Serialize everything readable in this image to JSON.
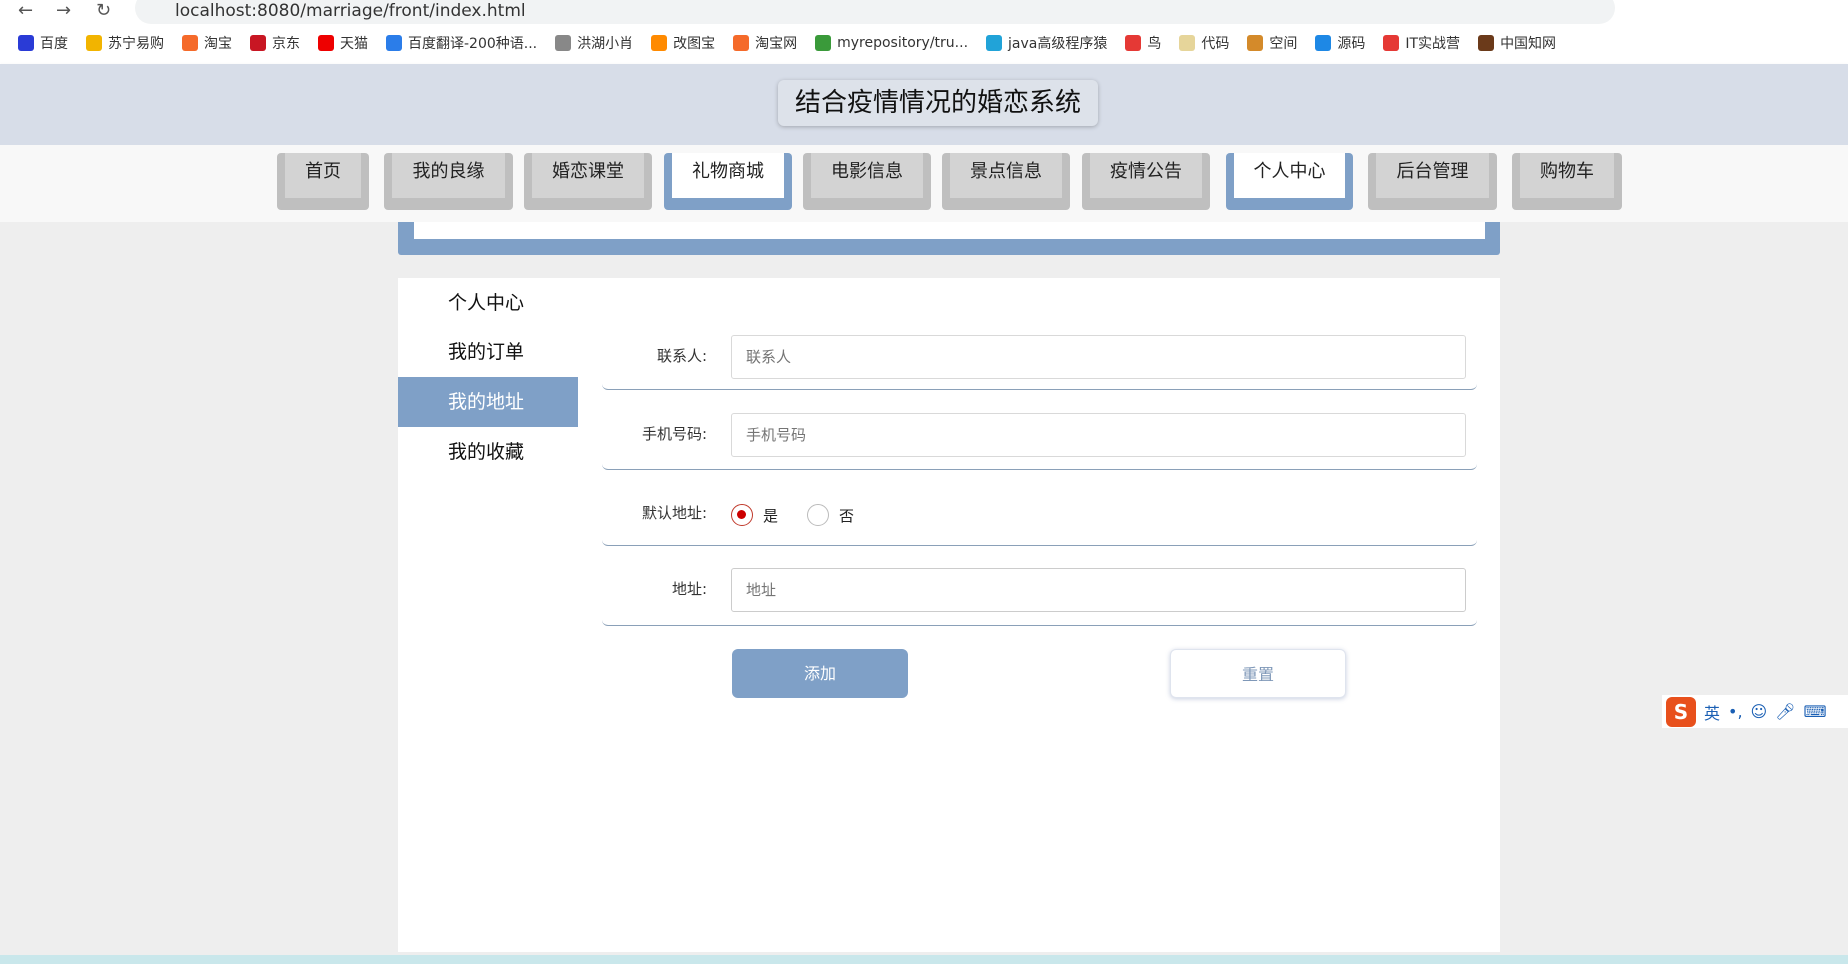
{
  "browser": {
    "url": "localhost:8080/marriage/front/index.html",
    "bookmarks": [
      {
        "label": "百度",
        "color": "#2a3bd6",
        "icon": "paw-icon"
      },
      {
        "label": "苏宁易购",
        "color": "#f2b400",
        "icon": "lion-icon"
      },
      {
        "label": "淘宝",
        "color": "#f56a2a",
        "icon": "taobao-icon"
      },
      {
        "label": "京东",
        "color": "#c81623",
        "icon": "jd-icon"
      },
      {
        "label": "天猫",
        "color": "#e00",
        "icon": "tmall-icon"
      },
      {
        "label": "百度翻译-200种语...",
        "color": "#2b7de9",
        "icon": "translate-icon"
      },
      {
        "label": "洪湖小肖",
        "color": "#888",
        "icon": "bird-icon"
      },
      {
        "label": "改图宝",
        "color": "#ff8a00",
        "icon": "image-icon"
      },
      {
        "label": "淘宝网",
        "color": "#f56a2a",
        "icon": "taobao-icon"
      },
      {
        "label": "myrepository/tru...",
        "color": "#3a9a3a",
        "icon": "repo-icon"
      },
      {
        "label": "java高级程序猿",
        "color": "#21a3d8",
        "icon": "bilibili-icon"
      },
      {
        "label": "鸟",
        "color": "#e53935",
        "icon": "bird-icon"
      },
      {
        "label": "代码",
        "color": "#e6d59a",
        "icon": "code-icon"
      },
      {
        "label": "空间",
        "color": "#d48a2a",
        "icon": "qzone-icon"
      },
      {
        "label": "源码",
        "color": "#1e88e5",
        "icon": "docker-icon"
      },
      {
        "label": "IT实战营",
        "color": "#e53935",
        "icon": "chrome-icon"
      },
      {
        "label": "中国知网",
        "color": "#6b3a1a",
        "icon": "cnki-icon"
      }
    ]
  },
  "header": {
    "title": "结合疫情情况的婚恋系统"
  },
  "nav": {
    "items": [
      {
        "label": "首页",
        "active": false
      },
      {
        "label": "我的良缘",
        "active": false
      },
      {
        "label": "婚恋课堂",
        "active": false
      },
      {
        "label": "礼物商城",
        "active": true
      },
      {
        "label": "电影信息",
        "active": false
      },
      {
        "label": "景点信息",
        "active": false
      },
      {
        "label": "疫情公告",
        "active": false
      },
      {
        "label": "个人中心",
        "active": true
      },
      {
        "label": "后台管理",
        "active": false
      },
      {
        "label": "购物车",
        "active": false
      }
    ]
  },
  "sidebar": {
    "items": [
      {
        "label": "个人中心"
      },
      {
        "label": "我的订单"
      },
      {
        "label": "我的地址",
        "active": true
      },
      {
        "label": "我的收藏"
      }
    ]
  },
  "form": {
    "contact": {
      "label": "联系人:",
      "placeholder": "联系人",
      "value": ""
    },
    "phone": {
      "label": "手机号码:",
      "placeholder": "手机号码",
      "value": ""
    },
    "default": {
      "label": "默认地址:",
      "options": [
        "是",
        "否"
      ],
      "selected": "是"
    },
    "address": {
      "label": "地址:",
      "placeholder": "地址",
      "value": ""
    },
    "add_label": "添加",
    "reset_label": "重置"
  },
  "ime": {
    "logo": "S",
    "mode": "英",
    "punct": "•,"
  },
  "colors": {
    "accent": "#7fa0c7",
    "header": "#d7dde8",
    "radio": "#cc0000"
  }
}
